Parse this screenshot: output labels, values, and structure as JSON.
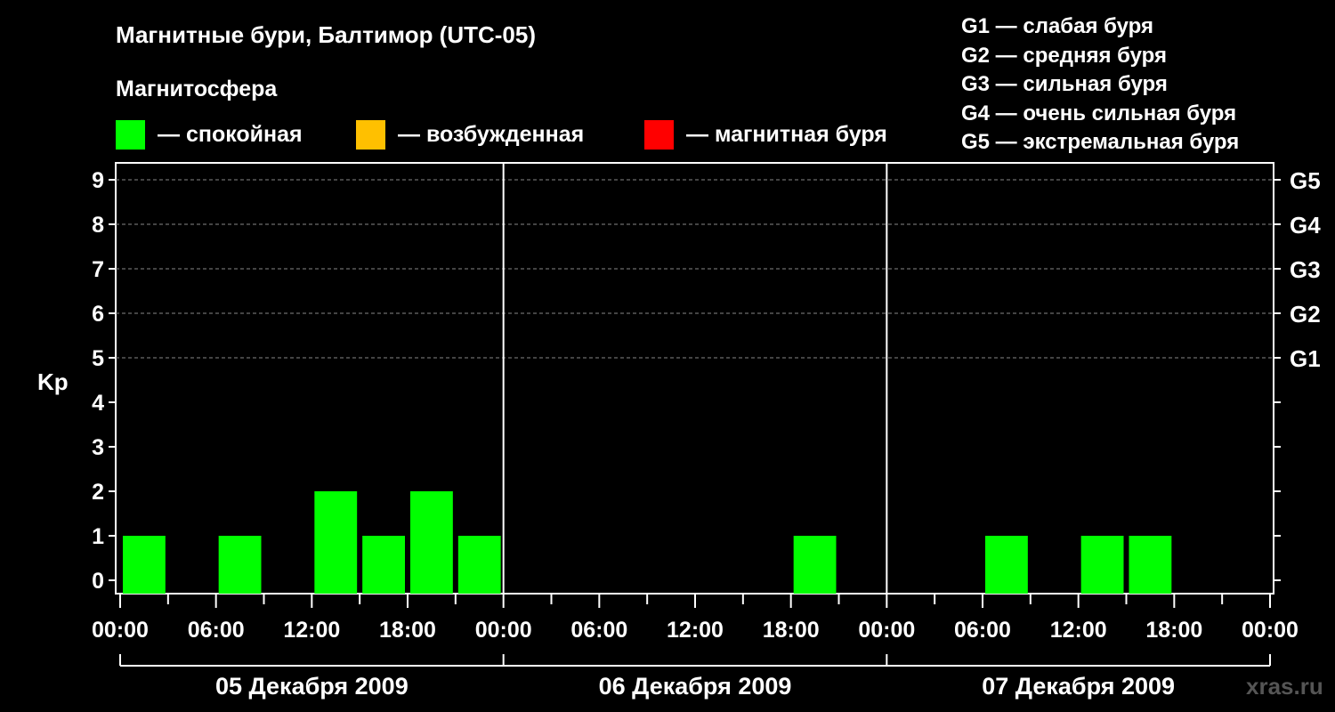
{
  "chart_data": {
    "type": "bar",
    "title": "Магнитные бури, Балтимор (UTC-05)",
    "ylabel": "Kp",
    "ylim": [
      0,
      9
    ],
    "yticks": [
      "0",
      "1",
      "2",
      "3",
      "4",
      "5",
      "6",
      "7",
      "8",
      "9"
    ],
    "right_ticks": [
      {
        "level": 5,
        "label": "G1"
      },
      {
        "level": 6,
        "label": "G2"
      },
      {
        "level": 7,
        "label": "G3"
      },
      {
        "level": 8,
        "label": "G4"
      },
      {
        "level": 9,
        "label": "G5"
      }
    ],
    "xticks": [
      "00:00",
      "06:00",
      "12:00",
      "18:00",
      "00:00",
      "06:00",
      "12:00",
      "18:00",
      "00:00",
      "06:00",
      "12:00",
      "18:00",
      "00:00"
    ],
    "days": [
      "05 Декабря 2009",
      "06 Декабря 2009",
      "07 Декабря 2009"
    ],
    "bar_interval_hours": 3,
    "values": [
      1,
      0,
      1,
      0,
      2,
      1,
      2,
      1,
      0,
      0,
      0,
      0,
      0,
      0,
      1,
      0,
      0,
      0,
      1,
      0,
      1,
      1,
      0,
      0
    ],
    "grid": "dashed horizontal at Kp 5-9",
    "legend_position": "top"
  },
  "header": {
    "title": "Магнитные бури, Балтимор (UTC-05)",
    "magnetosphere_label": "Магнитосфера"
  },
  "legend": [
    {
      "label": "— спокойная",
      "color": "#00ff00"
    },
    {
      "label": "— возбужденная",
      "color": "#ffc000"
    },
    {
      "label": "— магнитная буря",
      "color": "#ff0000"
    }
  ],
  "g_scale": [
    "G1 — слабая буря",
    "G2 — средняя буря",
    "G3 — сильная буря",
    "G4 — очень сильная буря",
    "G5 — экстремальная буря"
  ],
  "watermark": "xras.ru",
  "colors": {
    "quiet": "#00ff00",
    "active": "#ffc000",
    "storm": "#ff0000",
    "background": "#000000"
  }
}
